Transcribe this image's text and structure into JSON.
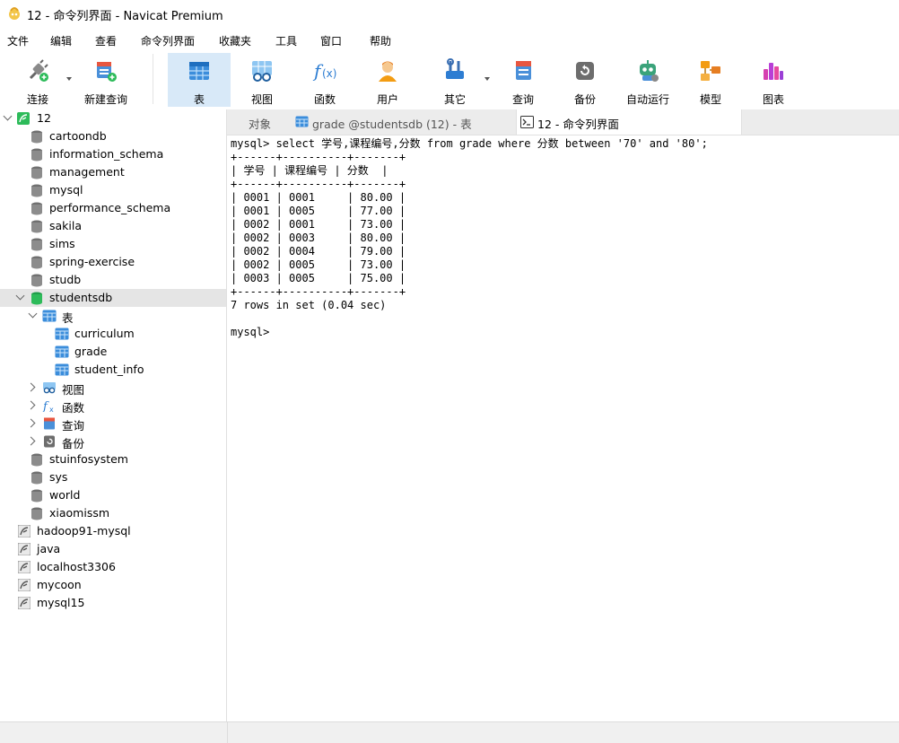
{
  "window": {
    "title": "12 - 命令列界面 - Navicat Premium"
  },
  "menu": [
    "文件",
    "编辑",
    "查看",
    "命令列界面",
    "收藏夹",
    "工具",
    "窗口",
    "帮助"
  ],
  "toolbar": {
    "items": [
      {
        "label": "连接",
        "icon": "plug-icon"
      },
      {
        "label": "新建查询",
        "icon": "new-query-icon"
      },
      {
        "label": "表",
        "icon": "table-icon"
      },
      {
        "label": "视图",
        "icon": "view-icon"
      },
      {
        "label": "函数",
        "icon": "function-icon"
      },
      {
        "label": "用户",
        "icon": "user-icon"
      },
      {
        "label": "其它",
        "icon": "tools-icon"
      },
      {
        "label": "查询",
        "icon": "query-icon"
      },
      {
        "label": "备份",
        "icon": "backup-icon"
      },
      {
        "label": "自动运行",
        "icon": "robot-icon"
      },
      {
        "label": "模型",
        "icon": "model-icon"
      },
      {
        "label": "图表",
        "icon": "chart-icon"
      }
    ]
  },
  "tree": {
    "connection": "12",
    "databases": [
      "cartoondb",
      "information_schema",
      "management",
      "mysql",
      "performance_schema",
      "sakila",
      "sims",
      "spring-exercise",
      "studb"
    ],
    "selected_db": "studentsdb",
    "tables_folder": "表",
    "tables": [
      "curriculum",
      "grade",
      "student_info"
    ],
    "folders": [
      "视图",
      "函数",
      "查询",
      "备份"
    ],
    "databases_after": [
      "stuinfosystem",
      "sys",
      "world",
      "xiaomissm"
    ],
    "connections": [
      "hadoop91-mysql",
      "java",
      "localhost3306",
      "mycoon",
      "mysql15"
    ]
  },
  "tabs": [
    {
      "label": "对象"
    },
    {
      "label": "grade @studentsdb (12) - 表"
    },
    {
      "label": "12 - 命令列界面"
    }
  ],
  "console": {
    "lines": [
      "mysql> select 学号,课程编号,分数 from grade where 分数 between '70' and '80';",
      "+------+----------+-------+",
      "| 学号 | 课程编号 | 分数  |",
      "+------+----------+-------+",
      "| 0001 | 0001     | 80.00 |",
      "| 0001 | 0005     | 77.00 |",
      "| 0002 | 0001     | 73.00 |",
      "| 0002 | 0003     | 80.00 |",
      "| 0002 | 0004     | 79.00 |",
      "| 0002 | 0005     | 73.00 |",
      "| 0003 | 0005     | 75.00 |",
      "+------+----------+-------+",
      "7 rows in set (0.04 sec)",
      "",
      "mysql> "
    ]
  },
  "colors": {
    "accent": "#1a73c8",
    "selected_bg": "#e5e5e5",
    "active_tool": "#d8e9f8",
    "db_green": "#2dbb5a"
  }
}
